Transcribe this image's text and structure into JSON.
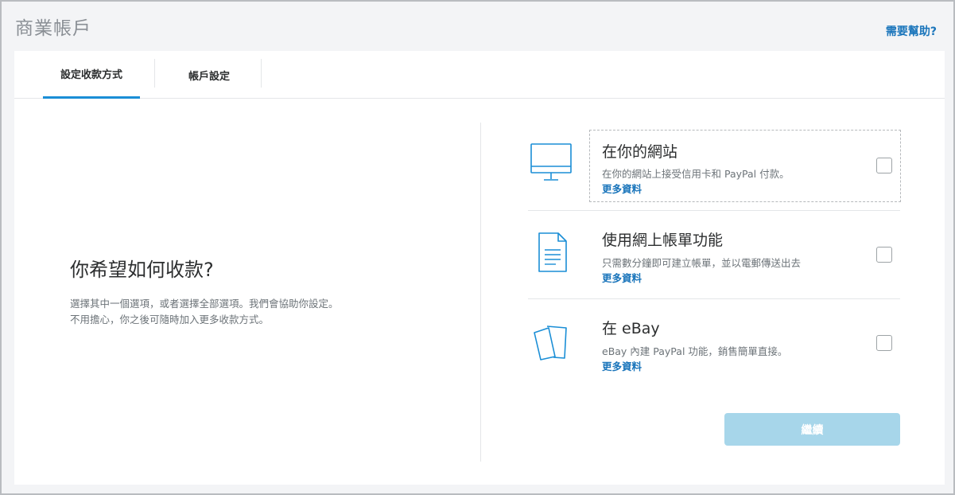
{
  "header": {
    "title": "商業帳戶",
    "help_link": "需要幫助?"
  },
  "tabs": [
    {
      "label": "設定收款方式",
      "active": true
    },
    {
      "label": "帳戶設定",
      "active": false
    }
  ],
  "intro": {
    "question": "你希望如何收款?",
    "description_line1": "選擇其中一個選項，或者選擇全部選項。我們會協助你設定。",
    "description_line2": "不用擔心，你之後可隨時加入更多收款方式。"
  },
  "options": [
    {
      "icon": "monitor-icon",
      "title": "在你的網站",
      "subtitle": "在你的網站上接受信用卡和 PayPal 付款。",
      "more": "更多資料",
      "checked": false
    },
    {
      "icon": "invoice-document-icon",
      "title": "使用網上帳單功能",
      "subtitle": "只需數分鐘即可建立帳單，並以電郵傳送出去",
      "more": "更多資料",
      "checked": false
    },
    {
      "icon": "ebay-cards-icon",
      "title": "在 eBay",
      "subtitle": "eBay 內建 PayPal 功能，銷售簡單直接。",
      "more": "更多資料",
      "checked": false
    }
  ],
  "continue_button": "繼續",
  "colors": {
    "accent": "#1a8ed6",
    "link": "#1a75bb",
    "icon": "#1a8ed6",
    "button_disabled": "#a7d6ea"
  }
}
